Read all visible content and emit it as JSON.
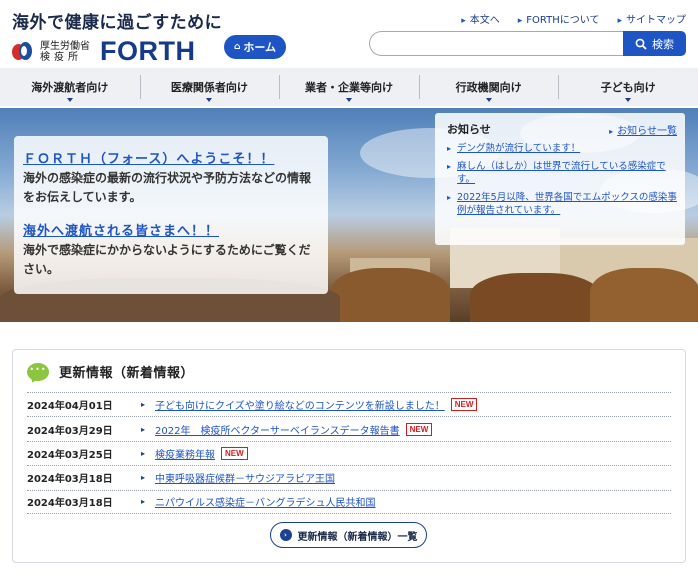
{
  "header": {
    "tagline": "海外で健康に過ごすために",
    "ministry_line1": "厚生労働省",
    "ministry_line2": "検疫所",
    "logo_text": "FORTH",
    "home_label": "ホーム",
    "top_links": [
      "本文へ",
      "FORTHについて",
      "サイトマップ"
    ],
    "search": {
      "placeholder": "",
      "button_label": "検索"
    }
  },
  "nav": {
    "items": [
      "海外渡航者向け",
      "医療関係者向け",
      "業者・企業等向け",
      "行政機関向け",
      "子ども向け"
    ]
  },
  "hero": {
    "welcome_heading": "ＦＯＲＴＨ（フォース）へようこそ！！",
    "welcome_text": "海外の感染症の最新の流行状況や予防方法などの情報をお伝えしています。",
    "travel_heading": "海外へ渡航される皆さまへ！！",
    "travel_text": "海外で感染症にかからないようにするためにご覧ください。"
  },
  "news": {
    "title": "お知らせ",
    "more_label": "お知らせ一覧",
    "items": [
      "デング熱が流行しています！",
      "麻しん（はしか）は世界で流行している感染症です。",
      "2022年5月以降、世界各国でエムポックスの感染事例が報告されています。"
    ]
  },
  "updates": {
    "title": "更新情報（新着情報）",
    "rows": [
      {
        "date": "2024年04月01日",
        "text": "子ども向けにクイズや塗り絵などのコンテンツを新設しました！",
        "badge": "NEW"
      },
      {
        "date": "2024年03月29日",
        "text": "2022年　検疫所ベクターサーベイランスデータ報告書",
        "badge": "NEW"
      },
      {
        "date": "2024年03月25日",
        "text": "検疫業務年報",
        "badge": "NEW"
      },
      {
        "date": "2024年03月18日",
        "text": "中東呼吸器症候群－サウジアラビア王国",
        "badge": ""
      },
      {
        "date": "2024年03月18日",
        "text": "ニパウイルス感染症－バングラデシュ人民共和国",
        "badge": ""
      }
    ],
    "list_button_label": "更新情報（新着情報）一覧"
  },
  "colors": {
    "brand_blue": "#1d55c4",
    "navy": "#163a8a",
    "new_badge": "#d11f1f",
    "chat_green": "#8cc63f"
  }
}
